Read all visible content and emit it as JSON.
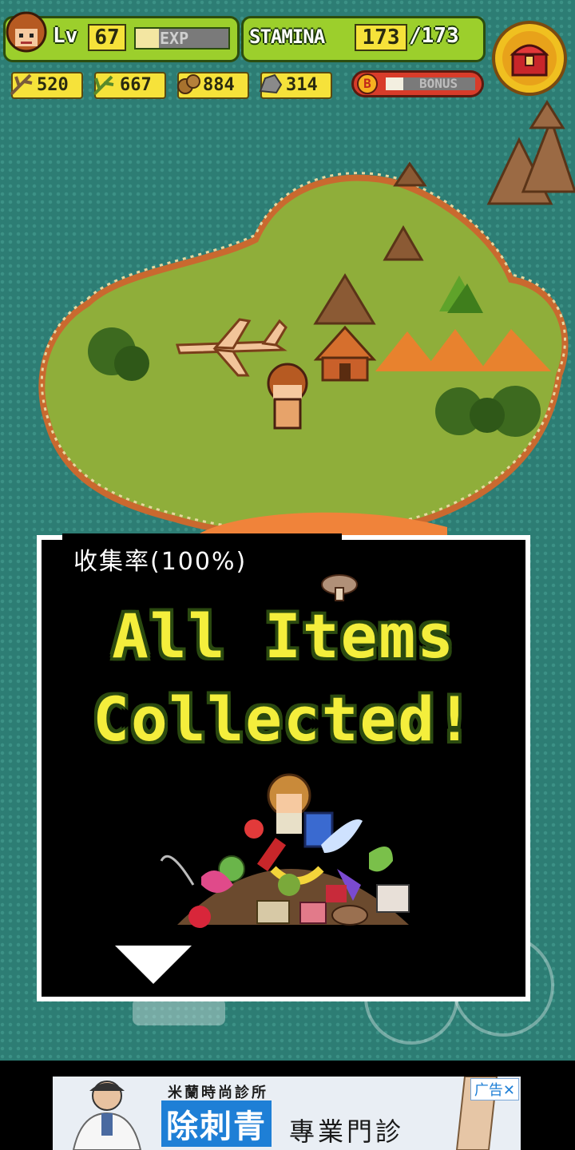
{
  "hud": {
    "level_label": "Lv",
    "level_value": "67",
    "exp_label": "EXP",
    "exp_fill": 0.25,
    "stamina_label": "STAMINA",
    "stamina_current": "173",
    "stamina_max": "/173",
    "bonus_label": "BONUS",
    "bonus_icon_text": "B",
    "bonus_fill": 0.2,
    "resources": [
      {
        "icon": "branch-icon",
        "value": "520"
      },
      {
        "icon": "grass-icon",
        "value": "667"
      },
      {
        "icon": "nut-icon",
        "value": "884"
      },
      {
        "icon": "stone-icon",
        "value": "314"
      }
    ],
    "menu_icon": "treasure-chest-icon"
  },
  "dialog": {
    "collection_rate": "收集率(100%)",
    "line1": "All Items",
    "line2": "Collected!",
    "next_icon": "down-triangle-icon"
  },
  "ad": {
    "top_text": "米蘭時尚診所",
    "main_text": "除刺青",
    "sub_text": "專業門診",
    "label": "广告✕"
  },
  "colors": {
    "sea": "#2d7d74",
    "island": "#8fae3a",
    "hud_green": "#9ccf2c",
    "title_yellow": "#f4ee3c"
  }
}
